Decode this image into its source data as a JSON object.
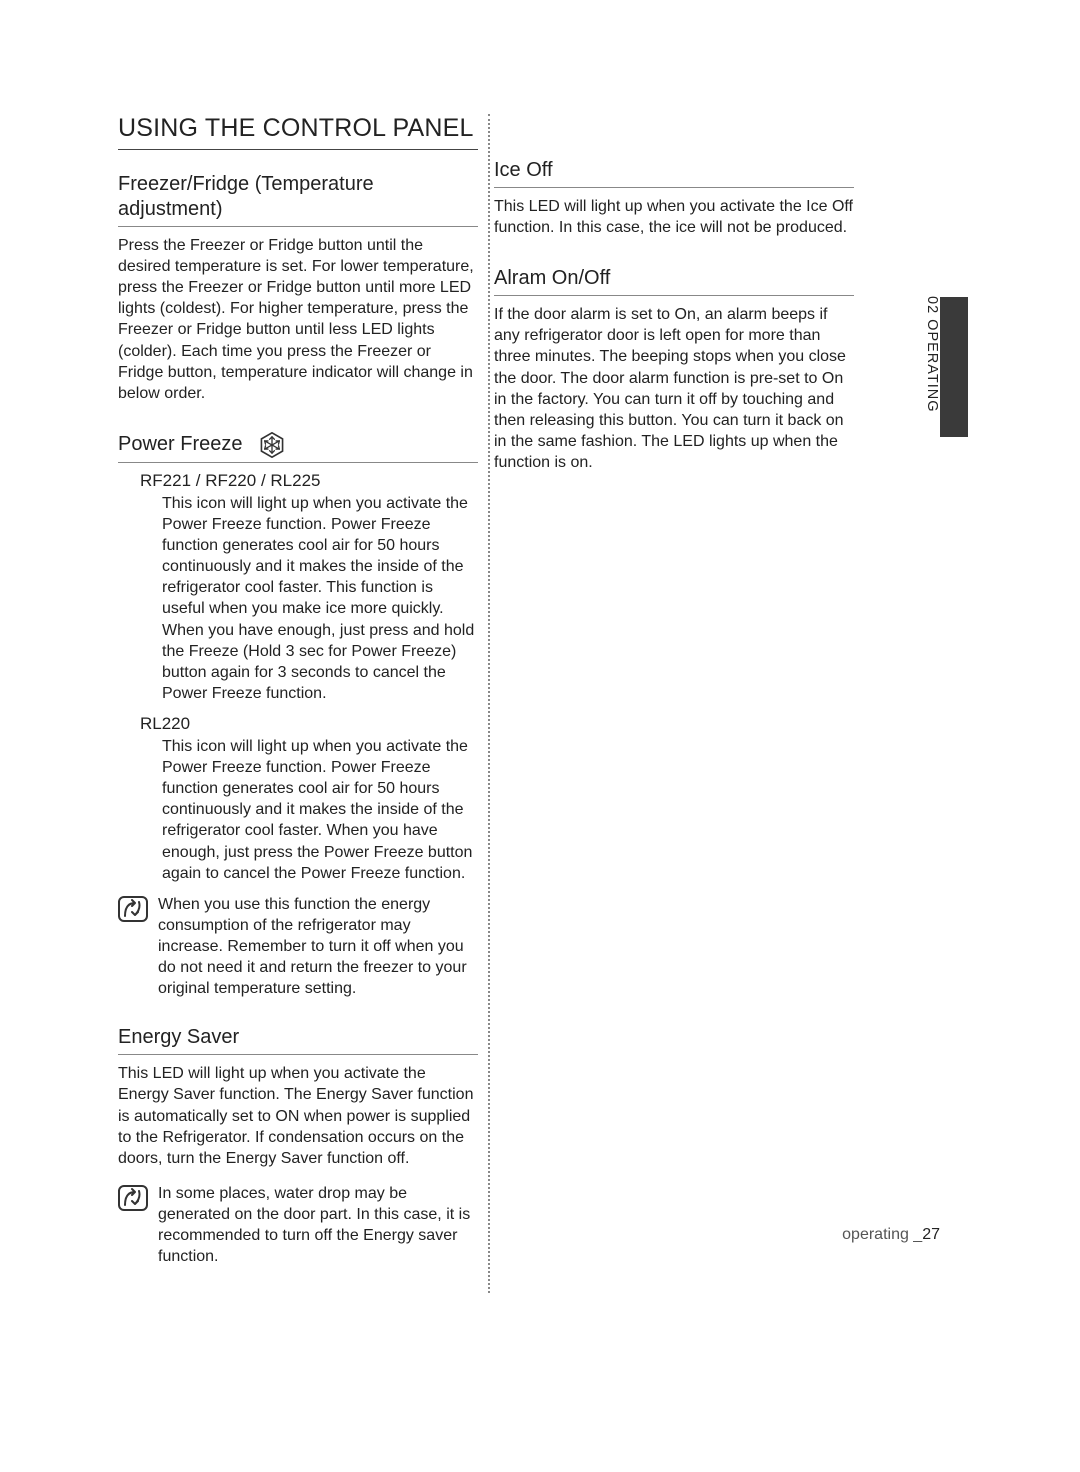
{
  "page": {
    "section_label_prefix": "02",
    "section_label_word": "OPERATING",
    "footer_section": "operating _",
    "footer_number": "27"
  },
  "left": {
    "h1": "USING THE CONTROL PANEL",
    "sec1": {
      "heading": "Freezer/Fridge (Temperature adjustment)",
      "body": "Press the Freezer or Fridge button until the desired temperature is set. For lower temperature, press the Freezer or Fridge button until more LED lights (coldest). For higher temperature, press the Freezer or Fridge button until less LED lights (colder). Each time you press the Freezer or Fridge button, temperature indicator will change in below order."
    },
    "sec2": {
      "heading": "Power Freeze",
      "sub1_title": "RF221 / RF220 / RL225",
      "sub1_body": "This icon will light up when you activate the Power Freeze function. Power Freeze function generates cool air for 50 hours continuously and it makes the inside of the refrigerator cool faster. This function is useful when you make ice more quickly. When you have enough, just press and hold the Freeze (Hold 3 sec for Power Freeze) button again for 3 seconds to cancel the Power Freeze function.",
      "sub2_title": "RL220",
      "sub2_body": "This icon will light up when you activate the Power Freeze function. Power Freeze function generates cool air for 50 hours continuously and it makes the inside of the refrigerator cool faster. When you have enough, just press the Power Freeze button again to cancel the Power Freeze function.",
      "note": "When you use this function the energy consumption of the refrigerator may increase. Remember to turn it off when you do not need it and return the freezer to your original temperature setting."
    },
    "sec3": {
      "heading": "Energy Saver",
      "body": "This LED will light up when you activate the Energy Saver function. The Energy Saver function is automatically set to  ON  when power is supplied to the Refrigerator. If condensation occurs on the doors, turn the Energy Saver function off.",
      "note": "In some places, water drop may be generated on the door part. In this case, it is recommended to turn off the Energy saver function."
    }
  },
  "right": {
    "sec1": {
      "heading": "Ice Off",
      "body": "This LED will light up when you activate the Ice Off function. In this case, the ice will not be produced."
    },
    "sec2": {
      "heading": "Alram On/Off",
      "body": "If the door alarm is set to On, an alarm beeps if any refrigerator door is left open for more than three minutes. The beeping stops when you close the door. The door alarm function is pre-set to On in the factory. You can turn it off by touching and then releasing this button. You can turn it back on in the same fashion. The LED lights up when the function is on."
    }
  },
  "icons": {
    "power_freeze": "snowflake-hex-icon",
    "note": "note-icon"
  }
}
